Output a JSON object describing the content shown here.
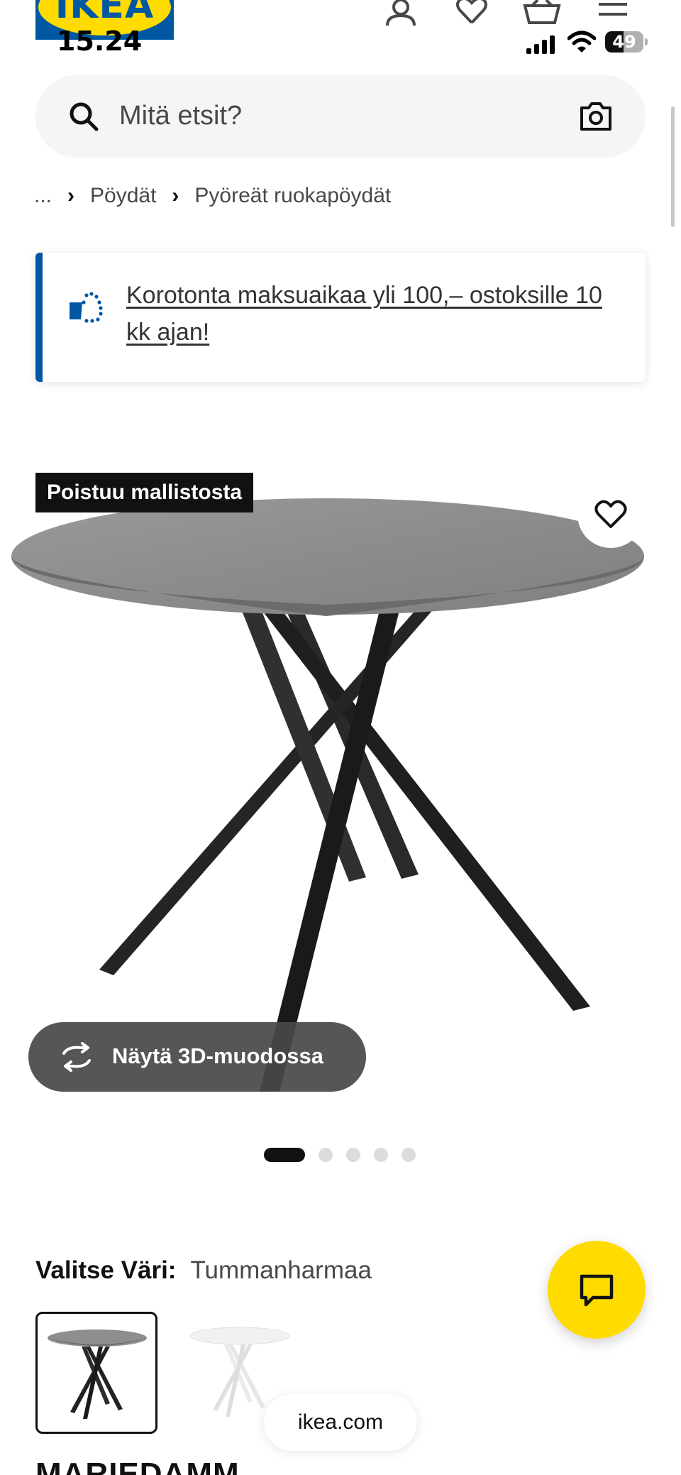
{
  "brand": {
    "logo_text": "IKEA",
    "primary_blue": "#0058a3",
    "yellow": "#ffdb00"
  },
  "status_bar": {
    "time": "15.24",
    "battery_level": "49",
    "battery_fraction": 0.49
  },
  "header": {
    "icons": [
      "profile-icon",
      "heart-icon",
      "basket-icon",
      "menu-icon"
    ]
  },
  "search": {
    "placeholder": "Mitä etsit?"
  },
  "breadcrumb": {
    "ellipsis": "...",
    "items": [
      "Pöydät",
      "Pyöreät ruokapöydät"
    ]
  },
  "promo": {
    "text": "Korotonta maksuaikaa yli 100,– ostoksille 10 kk ajan!"
  },
  "product": {
    "badge": "Poistuu mallistosta",
    "view_3d_label": "Näytä 3D-muodossa",
    "carousel": {
      "count": 5,
      "active_index": 0
    },
    "colour_label": "Valitse Väri:",
    "colour_value": "Tummanharmaa",
    "swatches": [
      "Tummanharmaa",
      "Valkoinen"
    ],
    "name": "MARIEDAMM"
  },
  "browser": {
    "url": "ikea.com"
  }
}
